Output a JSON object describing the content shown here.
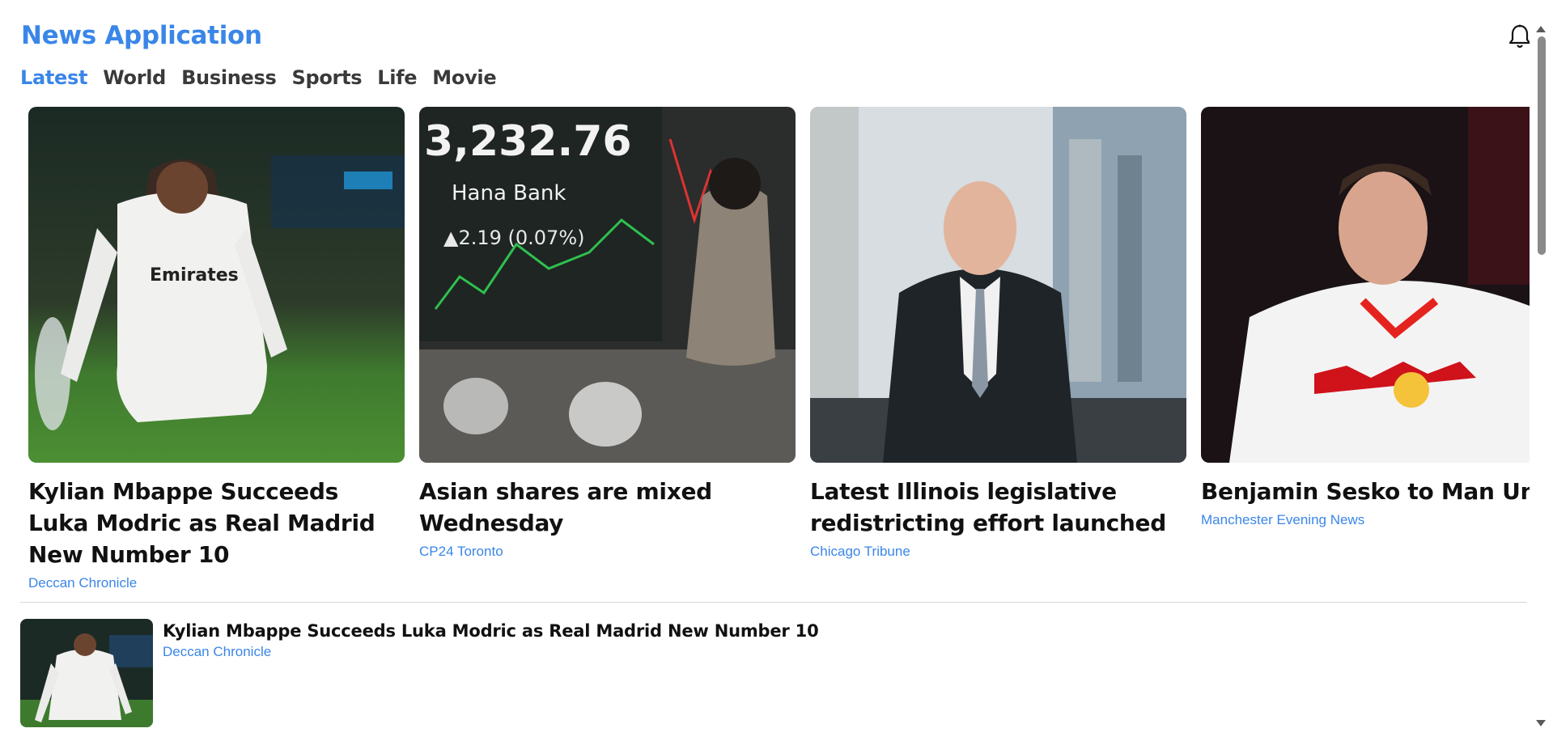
{
  "app": {
    "title": "News Application",
    "accent_color": "#3a86e8"
  },
  "header": {
    "notification_icon": "bell-icon"
  },
  "tabs": [
    {
      "label": "Latest",
      "active": true
    },
    {
      "label": "World",
      "active": false
    },
    {
      "label": "Business",
      "active": false
    },
    {
      "label": "Sports",
      "active": false
    },
    {
      "label": "Life",
      "active": false
    },
    {
      "label": "Movie",
      "active": false
    }
  ],
  "featured": [
    {
      "title": "Kylian Mbappe Succeeds Luka Modric as Real Madrid New Number 10",
      "source": "Deccan Chronicle"
    },
    {
      "title": "Asian shares are mixed Wednesday",
      "source": "CP24 Toronto",
      "image_text": {
        "index": "3,232.76",
        "bank": "Hana Bank",
        "change": "▲2.19 (0.07%)"
      }
    },
    {
      "title": "Latest Illinois legislative redistricting effort launched",
      "source": "Chicago Tribune"
    },
    {
      "title": "Benjamin Sesko to Man United transfer latest",
      "source": "Manchester Evening News"
    }
  ],
  "list": [
    {
      "title": "Kylian Mbappe Succeeds Luka Modric as Real Madrid New Number 10",
      "source": "Deccan Chronicle"
    }
  ]
}
